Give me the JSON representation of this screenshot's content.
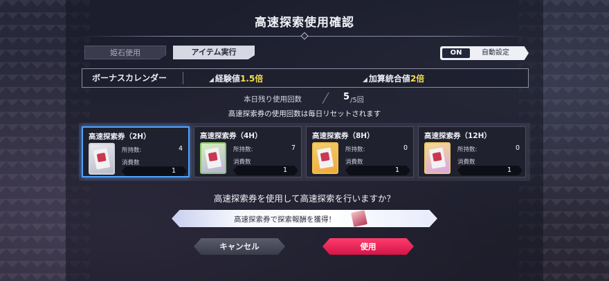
{
  "title": "高速探索使用確認",
  "tabs": [
    {
      "label": "姫石使用",
      "active": false
    },
    {
      "label": "アイテム実行",
      "active": true
    }
  ],
  "auto_setting": {
    "state": "ON",
    "label": "自動設定"
  },
  "bonus_calendar": {
    "label": "ボーナスカレンダー",
    "items": [
      {
        "label": "経験値",
        "value": "1.5倍"
      },
      {
        "label": "加算統合値",
        "value": "2倍"
      }
    ]
  },
  "remaining": {
    "label": "本日残り使用回数",
    "count": "5",
    "max": "/5回"
  },
  "reset_note": "高速探索券の使用回数は毎日リセットされます",
  "tickets": [
    {
      "name": "高速探索券（2H）",
      "own_label": "所持数:",
      "own": "4",
      "consume_label": "消費数",
      "consume": "1",
      "selected": true
    },
    {
      "name": "高速探索券（4H）",
      "own_label": "所持数:",
      "own": "7",
      "consume_label": "消費数",
      "consume": "1",
      "selected": false
    },
    {
      "name": "高速探索券（8H）",
      "own_label": "所持数:",
      "own": "0",
      "consume_label": "消費数",
      "consume": "1",
      "selected": false
    },
    {
      "name": "高速探索券（12H）",
      "own_label": "所持数:",
      "own": "0",
      "consume_label": "消費数",
      "consume": "1",
      "selected": false
    }
  ],
  "question": "高速探索券を使用して高速探索を行いますか？",
  "reward_banner": "高速探索券で探索報酬を獲得！",
  "buttons": {
    "cancel": "キャンセル",
    "use": "使用"
  },
  "colors": {
    "accent_pink": "#e8204f",
    "highlight_yellow": "#f5e14a",
    "selected_blue": "#4fa3ff"
  }
}
